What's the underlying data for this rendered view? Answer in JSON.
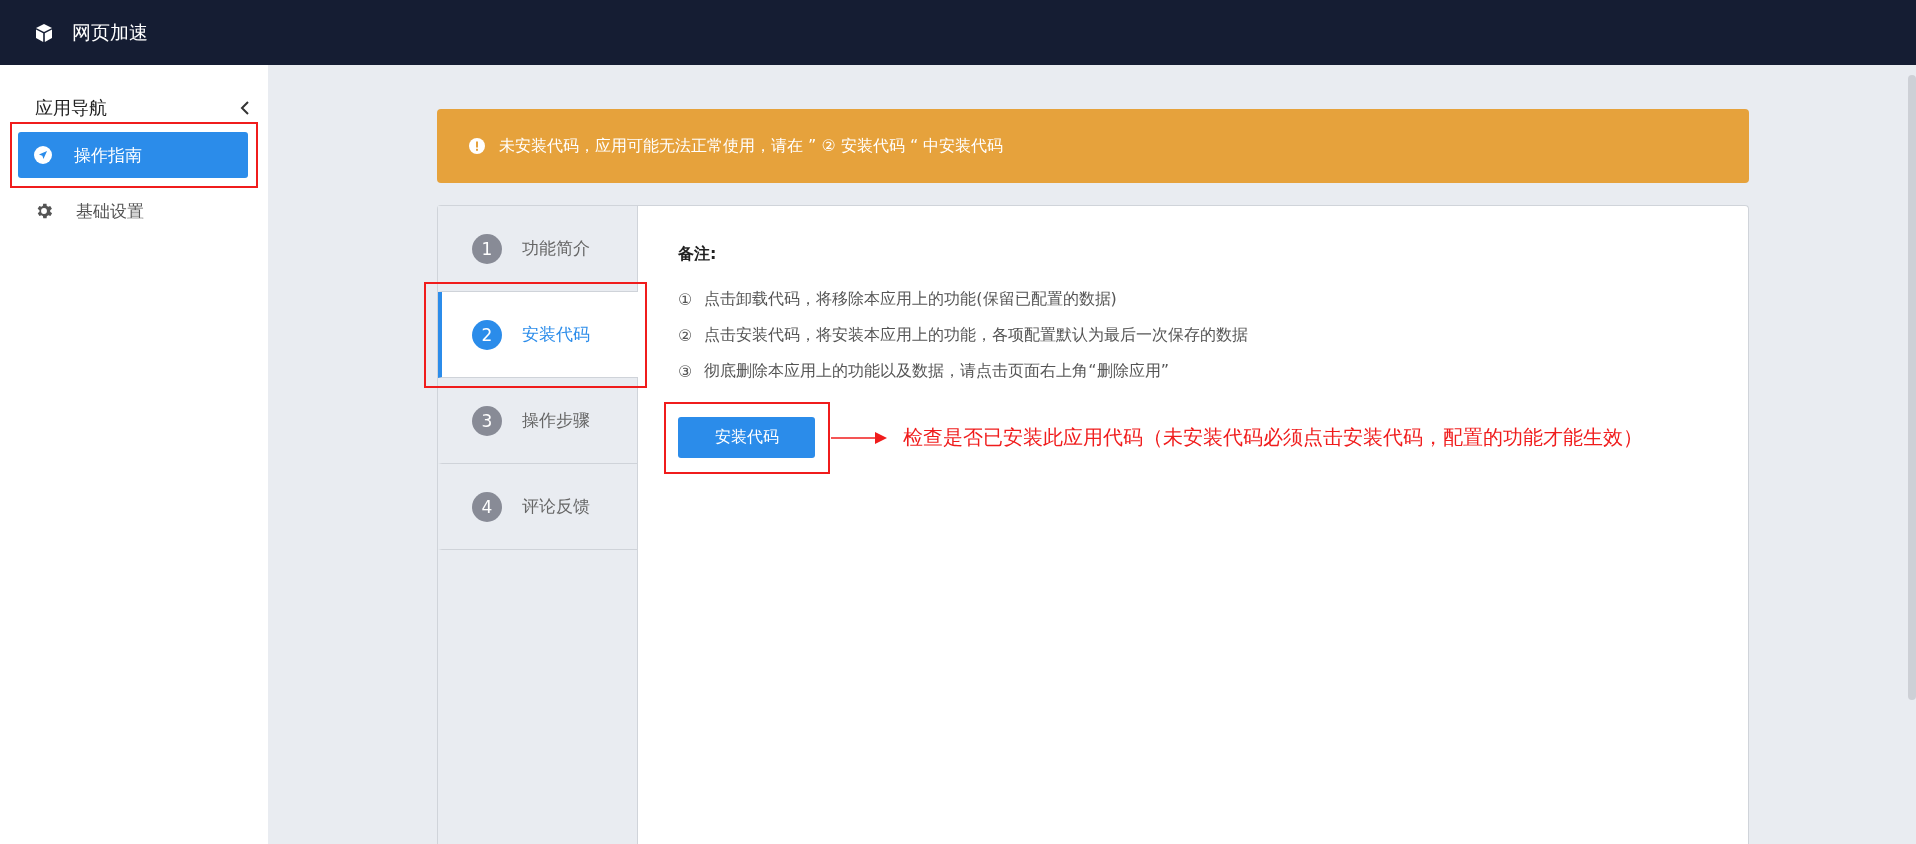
{
  "header": {
    "title": "网页加速"
  },
  "sidebar": {
    "title": "应用导航",
    "items": [
      {
        "label": "操作指南",
        "selected": true,
        "highlighted": true
      },
      {
        "label": "基础设置",
        "selected": false,
        "highlighted": false
      }
    ]
  },
  "alert": {
    "text": "未安装代码，应用可能无法正常使用，请在 ” ② 安装代码 “ 中安装代码"
  },
  "steps": [
    {
      "number": "1",
      "label": "功能简介",
      "selected": false,
      "highlighted": false
    },
    {
      "number": "2",
      "label": "安装代码",
      "selected": true,
      "highlighted": true
    },
    {
      "number": "3",
      "label": "操作步骤",
      "selected": false,
      "highlighted": false
    },
    {
      "number": "4",
      "label": "评论反馈",
      "selected": false,
      "highlighted": false
    }
  ],
  "notes": {
    "title": "备注:",
    "items": [
      {
        "marker": "①",
        "text": "点击卸载代码，将移除本应用上的功能(保留已配置的数据)"
      },
      {
        "marker": "②",
        "text": "点击安装代码，将安装本应用上的功能，各项配置默认为最后一次保存的数据"
      },
      {
        "marker": "③",
        "text": "彻底删除本应用上的功能以及数据，请点击页面右上角“删除应用”"
      }
    ]
  },
  "install_button": {
    "label": "安装代码",
    "highlighted": true
  },
  "annotation": {
    "text": "检查是否已安装此应用代码（未安装代码必须点击安装代码，配置的功能才能生效）"
  }
}
